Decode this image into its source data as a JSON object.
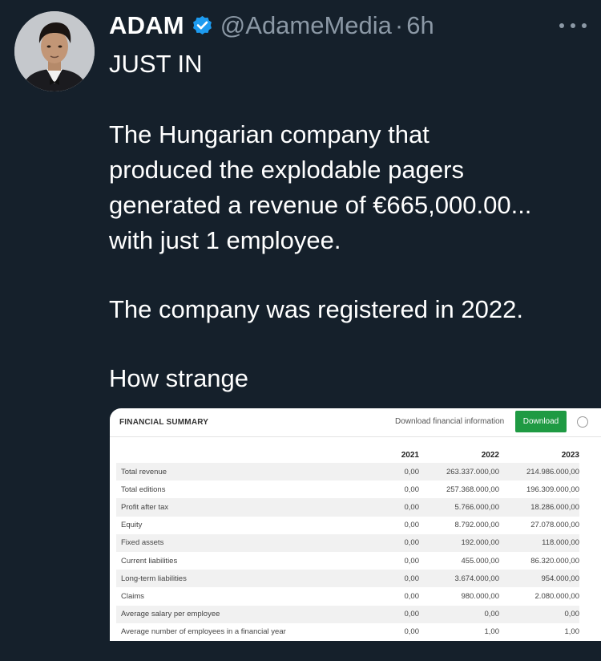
{
  "tweet": {
    "author_name": "ADAM",
    "handle": "@AdameMedia",
    "separator": "·",
    "time": "6h",
    "lines": [
      "JUST IN",
      "The Hungarian company that",
      "produced the explodable pagers",
      "generated a revenue of €665,000.00...",
      "with just 1 employee.",
      "The company was registered in 2022.",
      "How strange"
    ]
  },
  "icons": {
    "verified": "verified-badge-icon",
    "more": "more-horizontal-icon"
  },
  "colors": {
    "background": "#15202b",
    "secondary_text": "#8b98a5",
    "verified": "#1d9bf0",
    "download_button": "#1f9a43"
  },
  "image": {
    "title": "FINANCIAL SUMMARY",
    "download_text": "Download financial information",
    "download_button": "Download",
    "columns": [
      "",
      "2021",
      "2022",
      "2023"
    ],
    "rows": [
      [
        "Total revenue",
        "0,00",
        "263.337.000,00",
        "214.986.000,00"
      ],
      [
        "Total editions",
        "0,00",
        "257.368.000,00",
        "196.309.000,00"
      ],
      [
        "Profit after tax",
        "0,00",
        "5.766.000,00",
        "18.286.000,00"
      ],
      [
        "Equity",
        "0,00",
        "8.792.000,00",
        "27.078.000,00"
      ],
      [
        "Fixed assets",
        "0,00",
        "192.000,00",
        "118.000,00"
      ],
      [
        "Current liabilities",
        "0,00",
        "455.000,00",
        "86.320.000,00"
      ],
      [
        "Long-term liabilities",
        "0,00",
        "3.674.000,00",
        "954.000,00"
      ],
      [
        "Claims",
        "0,00",
        "980.000,00",
        "2.080.000,00"
      ],
      [
        "Average salary per employee",
        "0,00",
        "0,00",
        "0,00"
      ],
      [
        "Average number of employees in a financial year",
        "0,00",
        "1,00",
        "1,00"
      ]
    ]
  }
}
